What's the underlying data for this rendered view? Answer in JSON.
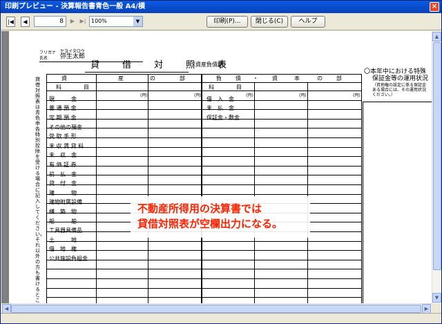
{
  "window": {
    "title": "印刷プレビュー - 決算報告書青色一般 A4/横",
    "close_label": "×"
  },
  "toolbar": {
    "first_label": "|◀",
    "prev_label": "◀",
    "page_value": "8",
    "next_label": "▶",
    "last_label": "▶|",
    "zoom_value": "100%",
    "zoom_arrow": "▼",
    "print_label": "印刷(P)...",
    "close_label": "閉じる(C)",
    "help_label": "ヘルプ"
  },
  "report": {
    "furigana_label": "フリガナ",
    "furigana_value": "ヤヨイタロウ",
    "name_label": "氏名",
    "name_value": "弥生太郎",
    "title": "貸　借　対　照　表",
    "subtitle": "（資産負債調）",
    "vertical_note": "貸借対照表は青色申告特別控除を受ける場合に記入してください。それ以外の方も書けるところは記入してください。",
    "assets_header": [
      "資",
      "産",
      "の",
      "部"
    ],
    "liab_header": [
      "負",
      "債",
      "・",
      "資",
      "本",
      "の",
      "部"
    ],
    "subject_label": "科　　　目",
    "asset_items": [
      "現　　　金",
      "普 通 預 金",
      "定 期 預 金",
      "その他の預金",
      "受 取 手 形",
      "未 収 賃 貸 料",
      "未　収　金",
      "有 価 証 券",
      "前　払　金",
      "貸　付　金",
      "建　　　物",
      "建物附属設備",
      "構　築　物",
      "船　　　舶",
      "工具器具備品",
      "土　　　地",
      "借　地　権",
      "公共施設負担金"
    ],
    "liab_items": [
      "借　入　金",
      "未　払　金",
      "保証金・敷金"
    ],
    "yen": "(円)",
    "side_note_title": "〇本年中における特殊",
    "side_note_line2": "保証金等の運用状況",
    "side_note_small": "（資地権の設定に係る保証金",
    "side_note_small2": "ある場合には、その運用状況",
    "side_note_small3": "ください。）"
  },
  "overlay": {
    "line1": "不動産所得用の決算書では",
    "line2": "貸借対照表が空欄出力になる。"
  },
  "colors": {
    "titlebar": "#0842b8",
    "overlay_text": "#ff2200"
  }
}
